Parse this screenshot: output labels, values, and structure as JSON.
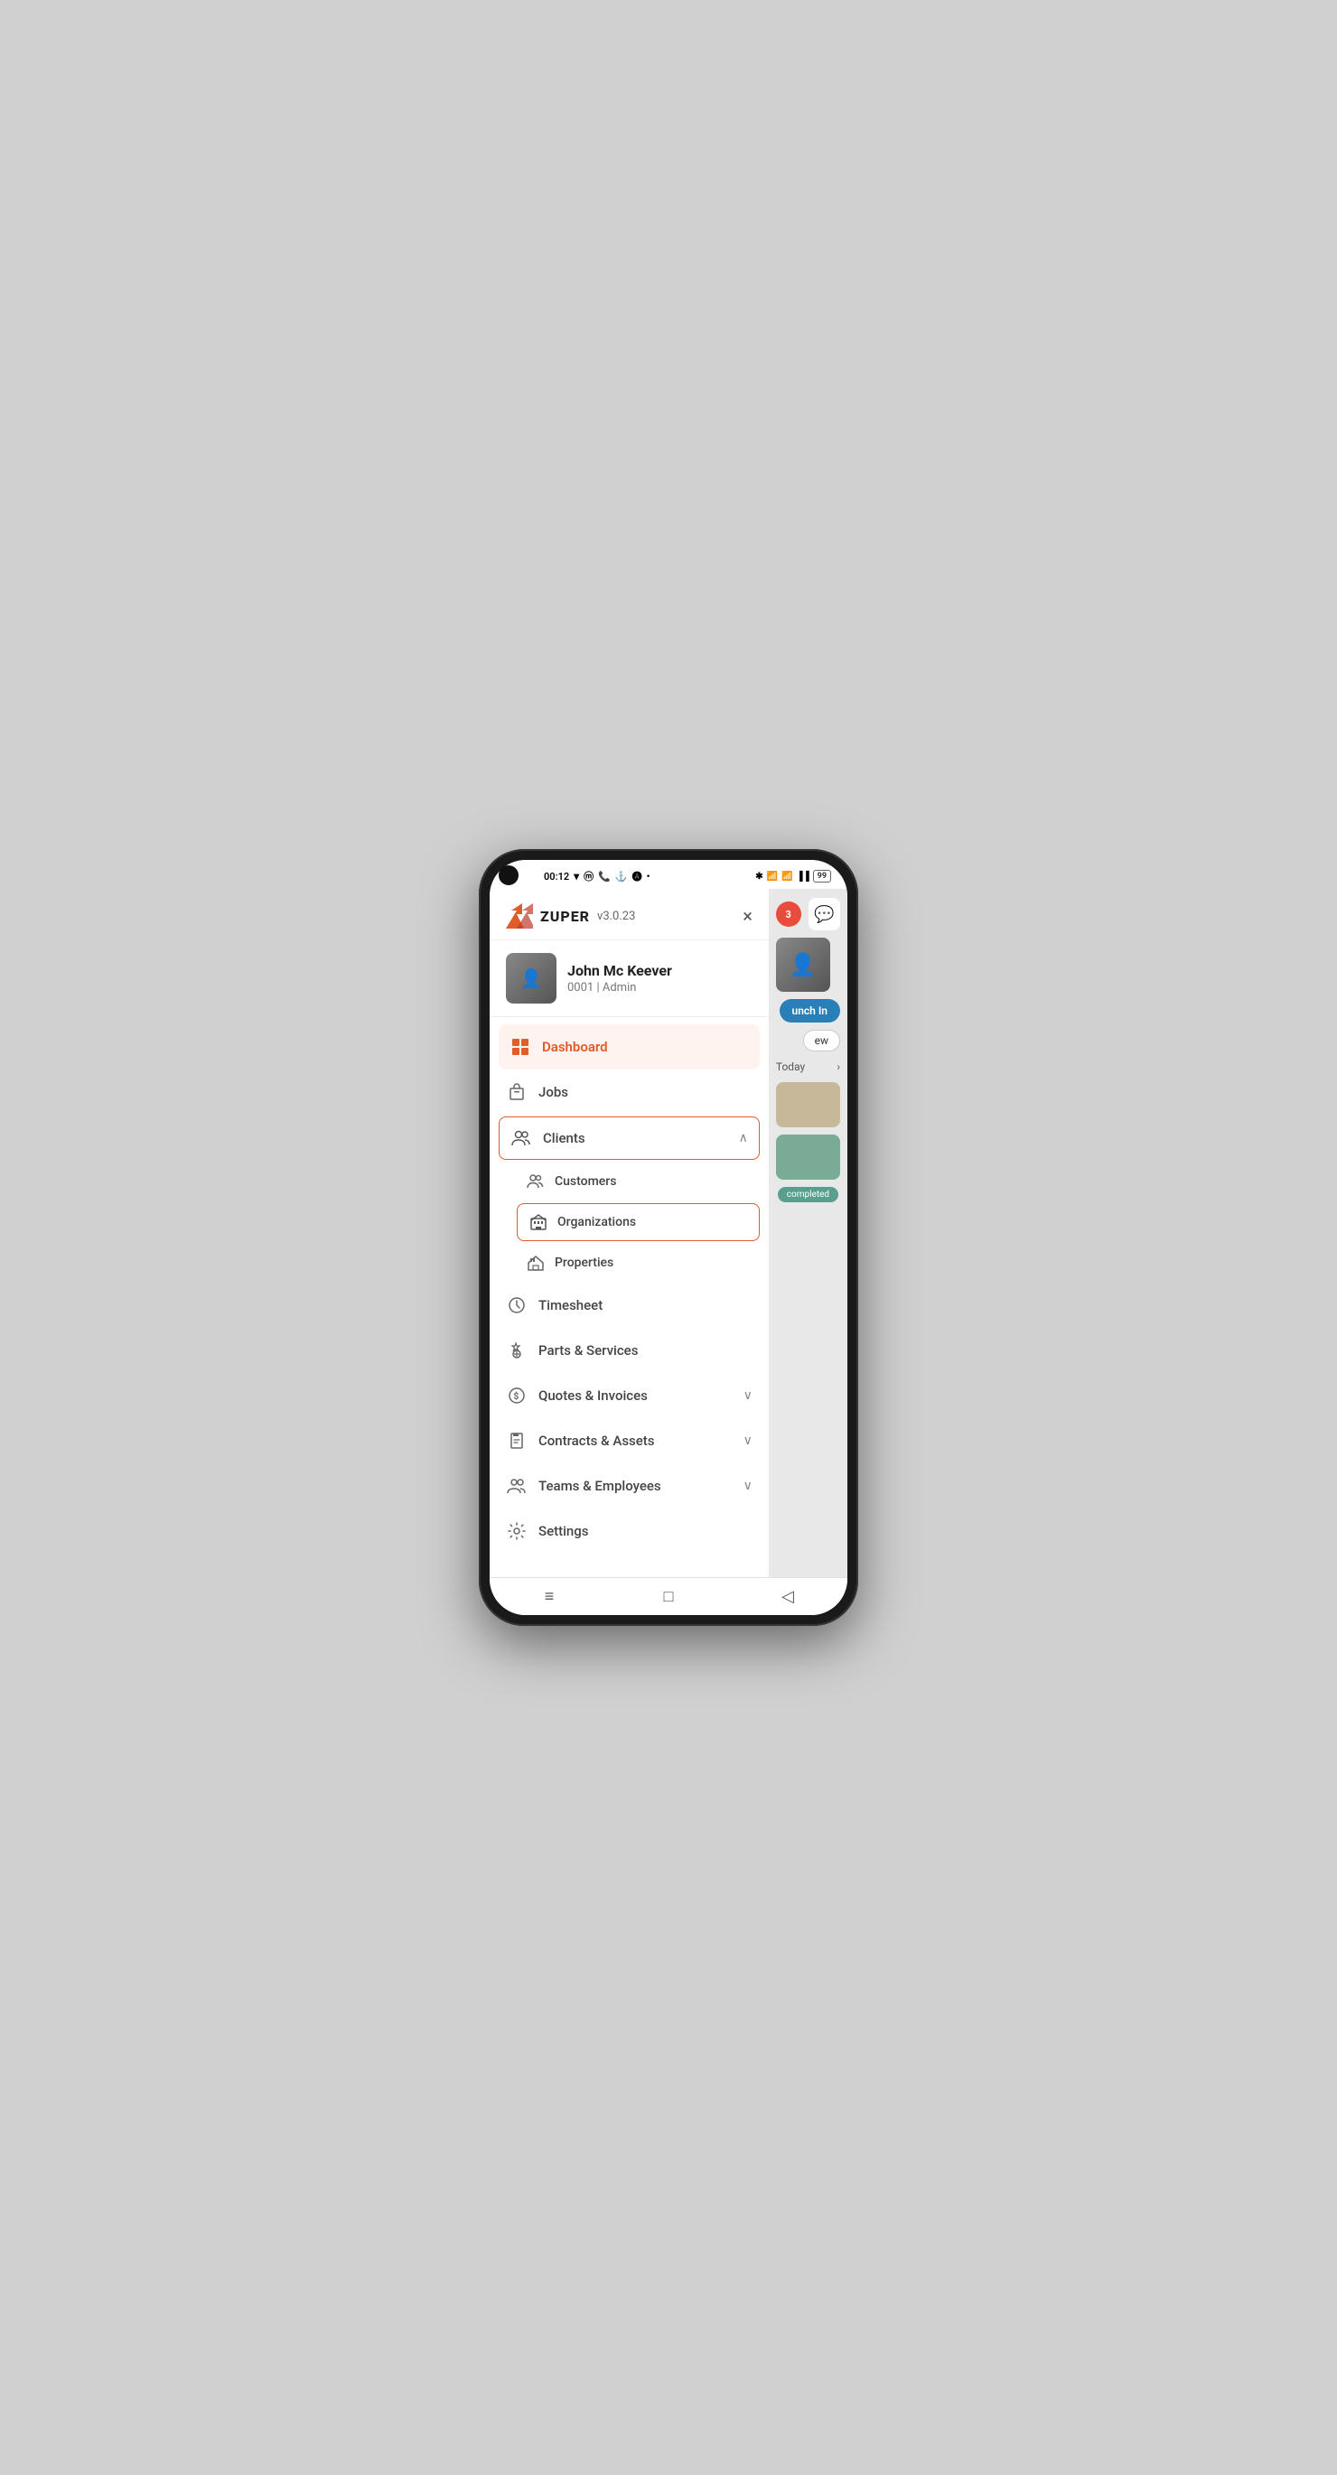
{
  "app": {
    "version": "v3.0.23",
    "close_label": "×"
  },
  "status_bar": {
    "time": "00:12",
    "battery": "99"
  },
  "user": {
    "name": "John Mc Keever",
    "id": "0001",
    "role": "Admin"
  },
  "nav": {
    "dashboard_label": "Dashboard",
    "jobs_label": "Jobs",
    "clients_label": "Clients",
    "customers_label": "Customers",
    "organizations_label": "Organizations",
    "properties_label": "Properties",
    "timesheet_label": "Timesheet",
    "parts_services_label": "Parts & Services",
    "quotes_invoices_label": "Quotes & Invoices",
    "contracts_assets_label": "Contracts & Assets",
    "teams_employees_label": "Teams & Employees",
    "settings_label": "Settings"
  },
  "behind": {
    "notification_count": "3",
    "today_label": "Today",
    "punch_in_label": "unch In",
    "new_label": "ew"
  },
  "bottom_bar": {
    "menu_label": "≡",
    "home_label": "□",
    "back_label": "◁"
  }
}
